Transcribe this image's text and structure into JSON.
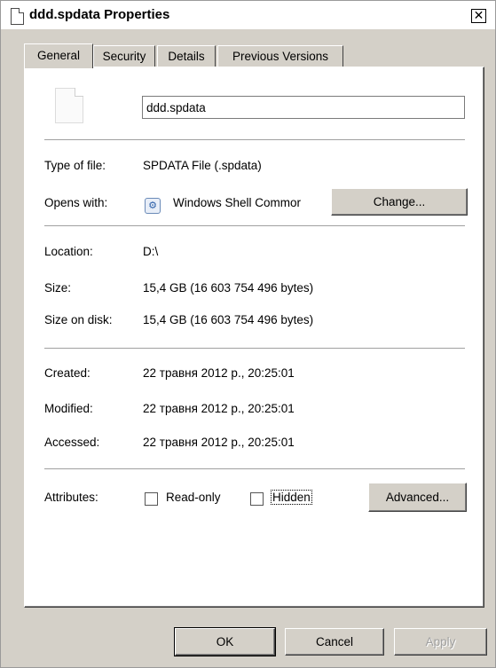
{
  "window": {
    "title": "ddd.spdata Properties",
    "close_glyph": "✕"
  },
  "tabs": [
    {
      "label": "General",
      "active": true
    },
    {
      "label": "Security",
      "active": false
    },
    {
      "label": "Details",
      "active": false
    },
    {
      "label": "Previous Versions",
      "active": false
    }
  ],
  "general": {
    "file_name": "ddd.spdata",
    "type_label": "Type of file:",
    "type_value": "SPDATA File (.spdata)",
    "opens_label": "Opens with:",
    "opens_value": "Windows Shell Commor",
    "change_button": "Change...",
    "location_label": "Location:",
    "location_value": "D:\\",
    "size_label": "Size:",
    "size_value": "15,4 GB (16 603 754 496 bytes)",
    "size_on_disk_label": "Size on disk:",
    "size_on_disk_value": "15,4 GB (16 603 754 496 bytes)",
    "created_label": "Created:",
    "created_value": "22 травня 2012 р., 20:25:01",
    "modified_label": "Modified:",
    "modified_value": "22 травня 2012 р., 20:25:01",
    "accessed_label": "Accessed:",
    "accessed_value": "22 травня 2012 р., 20:25:01",
    "attributes_label": "Attributes:",
    "readonly_label": "Read-only",
    "readonly_checked": false,
    "hidden_label": "Hidden",
    "hidden_checked": false,
    "advanced_button": "Advanced..."
  },
  "footer": {
    "ok_button": "OK",
    "cancel_button": "Cancel",
    "apply_button": "Apply"
  }
}
